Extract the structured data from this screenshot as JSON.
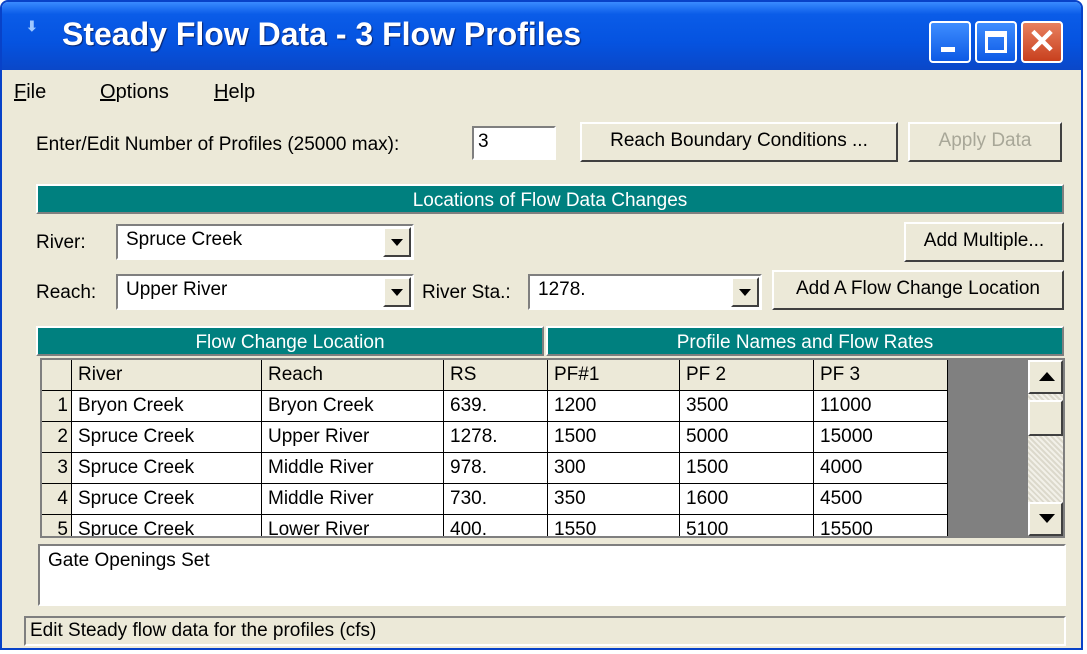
{
  "window": {
    "title": "Steady Flow Data - 3 Flow Profiles"
  },
  "menu": {
    "file": "F",
    "file_rest": "ile",
    "options": "O",
    "options_rest": "ptions",
    "help": "H",
    "help_rest": "elp"
  },
  "profiles": {
    "label": "Enter/Edit Number of Profiles (25000 max):",
    "value": "3",
    "reach_boundary_button": "Reach Boundary Conditions ...",
    "apply_button": "Apply Data"
  },
  "locations_header": "Locations of Flow Data Changes",
  "river": {
    "label": "River:",
    "value": "Spruce Creek"
  },
  "add_multiple_button": "Add Multiple...",
  "reach": {
    "label": "Reach:",
    "value": "Upper River"
  },
  "river_sta": {
    "label": "River Sta.:",
    "value": "1278."
  },
  "add_flow_change_button": "Add A Flow Change Location",
  "table": {
    "location_header": "Flow Change Location",
    "profile_header": "Profile Names and Flow Rates",
    "columns": [
      "River",
      "Reach",
      "RS",
      "PF#1",
      "PF 2",
      "PF 3"
    ],
    "rows": [
      {
        "num": "1",
        "cells": [
          "Bryon Creek",
          "Bryon Creek",
          "639.",
          "1200",
          "3500",
          "11000"
        ]
      },
      {
        "num": "2",
        "cells": [
          "Spruce Creek",
          "Upper River",
          "1278.",
          "1500",
          "5000",
          "15000"
        ]
      },
      {
        "num": "3",
        "cells": [
          "Spruce Creek",
          "Middle River",
          "978.",
          "300",
          "1500",
          "4000"
        ]
      },
      {
        "num": "4",
        "cells": [
          "Spruce Creek",
          "Middle River",
          "730.",
          "350",
          "1600",
          "4500"
        ]
      },
      {
        "num": "5",
        "cells": [
          "Spruce Creek",
          "Lower River",
          "400.",
          "1550",
          "5100",
          "15500"
        ]
      }
    ]
  },
  "notes": "Gate Openings Set",
  "status": "Edit Steady flow data for the profiles (cfs)"
}
